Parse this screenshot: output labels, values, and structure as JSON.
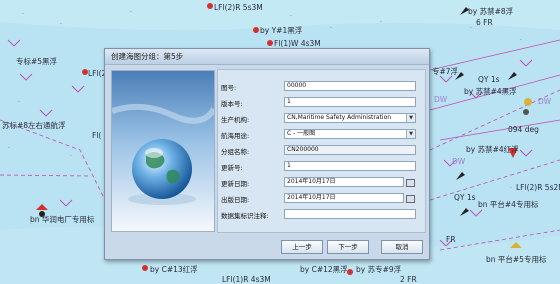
{
  "dialog": {
    "title": "创建海图分组：第5步",
    "fields": [
      {
        "label": "图号:",
        "value": "00000",
        "type": "text"
      },
      {
        "label": "版本号:",
        "value": "1",
        "type": "text"
      },
      {
        "label": "生产机构:",
        "value": "CN,Maritime Safety Administration",
        "type": "select"
      },
      {
        "label": "航海用途:",
        "value": "C - 一般图",
        "type": "select"
      },
      {
        "label": "分组名称:",
        "value": "CN200000",
        "type": "readonly"
      },
      {
        "label": "更新号:",
        "value": "1",
        "type": "text"
      },
      {
        "label": "更新日期:",
        "value": "2014年10月17日",
        "type": "date"
      },
      {
        "label": "出版日期:",
        "value": "2014年10月17日",
        "type": "date"
      },
      {
        "label": "数据集标识注释:",
        "value": "",
        "type": "text"
      }
    ],
    "buttons": {
      "prev": "上一步",
      "next": "下一步",
      "cancel": "取消"
    }
  },
  "map_labels": [
    "LFl(2)R 5s3M",
    "by 苏禁#8浮",
    "by Y#1黑浮",
    "Fl(1)W 4s3M",
    "6 FR",
    "专标#5黑浮",
    "LFl(2)",
    "专#7浮",
    "QY 1s",
    "by 苏禁#4黑浮",
    "DW",
    "DW",
    "094 deg",
    "苏标#8左右通航浮",
    "Fl(",
    "by 苏禁#4红浮",
    "LFl(2)R 5s2M",
    "DW",
    "QY 1s",
    "bn 平台#4专用标",
    "bn 华润电厂专用标",
    "FR",
    "bn 平台#5专用标",
    "by C#13红浮",
    "LFl(1)R 4s3M",
    "by C#12黑浮",
    "by 苏专#9浮",
    "2 FR"
  ]
}
